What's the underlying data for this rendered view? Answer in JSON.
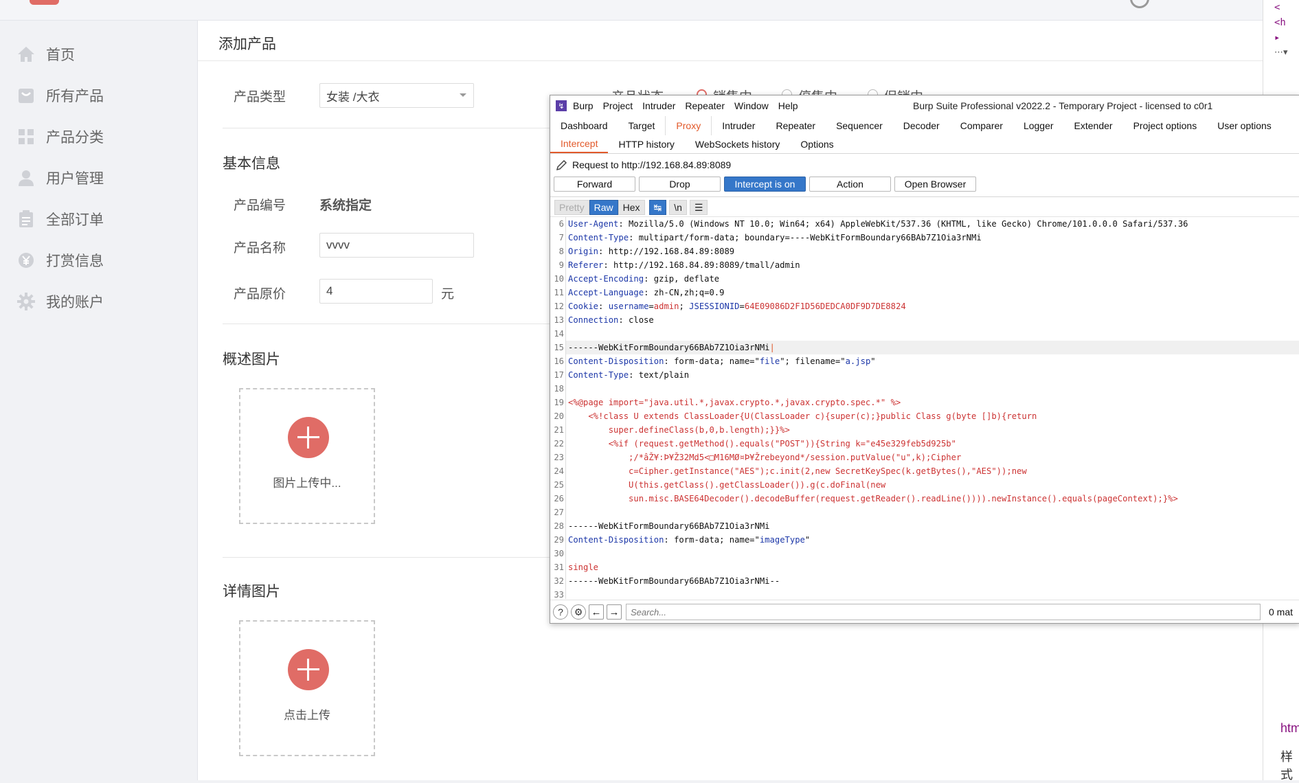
{
  "sidebar": {
    "items": [
      {
        "label": "首页",
        "icon": "home-icon"
      },
      {
        "label": "所有产品",
        "icon": "bag-icon"
      },
      {
        "label": "产品分类",
        "icon": "grid-icon"
      },
      {
        "label": "用户管理",
        "icon": "user-icon"
      },
      {
        "label": "全部订单",
        "icon": "order-icon"
      },
      {
        "label": "打赏信息",
        "icon": "yen-icon"
      },
      {
        "label": "我的账户",
        "icon": "gear-icon"
      }
    ]
  },
  "main": {
    "title": "添加产品",
    "type_label": "产品类型",
    "type_value": "女装 /大衣",
    "status_label": "产品状态",
    "status_options": [
      "销售中",
      "停售中",
      "促销中"
    ],
    "basic_section": "基本信息",
    "code_label": "产品编号",
    "code_value": "系统指定",
    "name_label": "产品名称",
    "name_value": "vvvv",
    "price_label": "产品原价",
    "price_value": "4",
    "price_unit": "元",
    "overview_section": "概述图片",
    "overview_upload_text": "图片上传中...",
    "detail_section": "详情图片",
    "detail_upload_text": "点击上传"
  },
  "burp": {
    "menus": [
      "Burp",
      "Project",
      "Intruder",
      "Repeater",
      "Window",
      "Help"
    ],
    "title": "Burp Suite Professional v2022.2 - Temporary Project - licensed to c0r1",
    "tabs": [
      "Dashboard",
      "Target",
      "Proxy",
      "Intruder",
      "Repeater",
      "Sequencer",
      "Decoder",
      "Comparer",
      "Logger",
      "Extender",
      "Project options",
      "User options"
    ],
    "active_tab": "Proxy",
    "subtabs": [
      "Intercept",
      "HTTP history",
      "WebSockets history",
      "Options"
    ],
    "active_subtab": "Intercept",
    "request_to": "Request to http://192.168.84.89:8089",
    "buttons": {
      "forward": "Forward",
      "drop": "Drop",
      "intercept": "Intercept is on",
      "action": "Action",
      "open_browser": "Open Browser"
    },
    "view": {
      "pretty": "Pretty",
      "raw": "Raw",
      "hex": "Hex",
      "newline": "\\n"
    },
    "search_placeholder": "Search...",
    "matches": "0 mat",
    "accent": "#e2592a",
    "button_blue": "#3577c9"
  },
  "right_pane": {
    "html_label": "htm",
    "styles_label": "样式"
  },
  "brand_color": "#e06c66"
}
